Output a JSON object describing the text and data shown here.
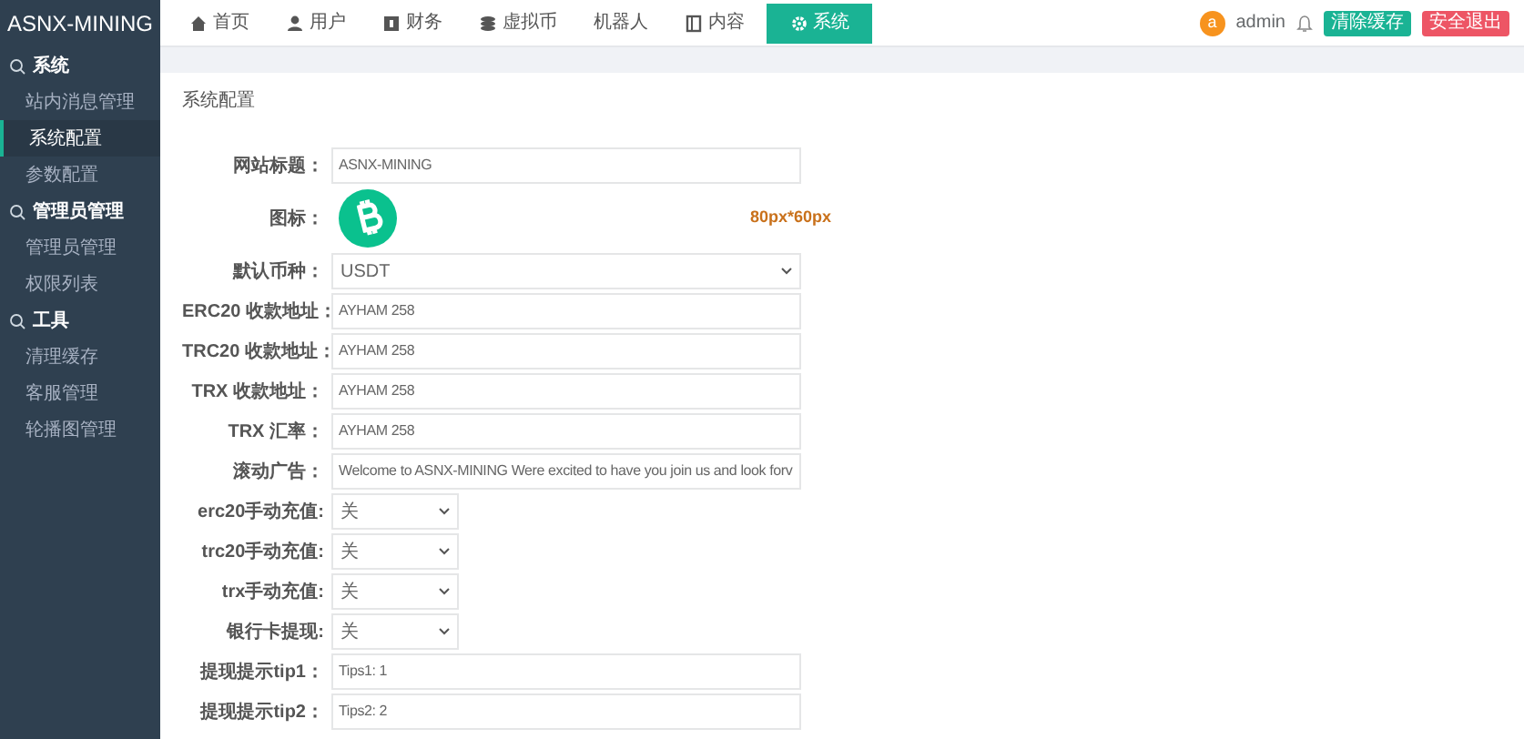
{
  "brand": "ASNX-MINING",
  "sidebar": [
    {
      "heading": "系统",
      "items": [
        {
          "label": "站内消息管理",
          "selected": false
        },
        {
          "label": "系统配置",
          "selected": true
        },
        {
          "label": "参数配置",
          "selected": false
        }
      ]
    },
    {
      "heading": "管理员管理",
      "items": [
        {
          "label": "管理员管理",
          "selected": false
        },
        {
          "label": "权限列表",
          "selected": false
        }
      ]
    },
    {
      "heading": "工具",
      "items": [
        {
          "label": "清理缓存",
          "selected": false
        },
        {
          "label": "客服管理",
          "selected": false
        },
        {
          "label": "轮播图管理",
          "selected": false
        }
      ]
    }
  ],
  "nav": [
    {
      "label": "首页",
      "selected": false
    },
    {
      "label": "用户",
      "selected": false
    },
    {
      "label": "财务",
      "selected": false
    },
    {
      "label": "虚拟币",
      "selected": false
    },
    {
      "label": "机器人",
      "selected": false
    },
    {
      "label": "内容",
      "selected": false
    },
    {
      "label": "系统",
      "selected": true
    }
  ],
  "user": {
    "avatar": "a",
    "name": "admin"
  },
  "actions": [
    {
      "label": "清除缓存",
      "kind": "primary"
    },
    {
      "label": "安全退出",
      "kind": "danger"
    }
  ],
  "page_title": "系统配置",
  "form": [
    {
      "kind": "input",
      "label": "网站标题：",
      "value": "ASNX-MINING"
    },
    {
      "kind": "icon",
      "label": "图标：",
      "hint": "80px*60px"
    },
    {
      "kind": "select",
      "label": "默认币种：",
      "value": "USDT"
    },
    {
      "kind": "input",
      "label": "ERC20 收款地址：",
      "value": "AYHAM 258"
    },
    {
      "kind": "input",
      "label": "TRC20 收款地址：",
      "value": "AYHAM 258"
    },
    {
      "kind": "input",
      "label": "TRX 收款地址：",
      "value": "AYHAM 258"
    },
    {
      "kind": "input",
      "label": "TRX 汇率：",
      "value": "AYHAM 258"
    },
    {
      "kind": "input",
      "label": "滚动广告：",
      "value": "Welcome to ASNX-MINING Were excited to have you join us and look forv"
    },
    {
      "kind": "toggle",
      "label": "erc20手动充值:",
      "value": "关"
    },
    {
      "kind": "toggle",
      "label": "trc20手动充值:",
      "value": "关"
    },
    {
      "kind": "toggle",
      "label": "trx手动充值:",
      "value": "关"
    },
    {
      "kind": "toggle",
      "label": "银行卡提现:",
      "value": "关"
    },
    {
      "kind": "input",
      "label": "提现提示tip1：",
      "value": "Tips1: 1"
    },
    {
      "kind": "input",
      "label": "提现提示tip2：",
      "value": "Tips2: 2"
    }
  ]
}
